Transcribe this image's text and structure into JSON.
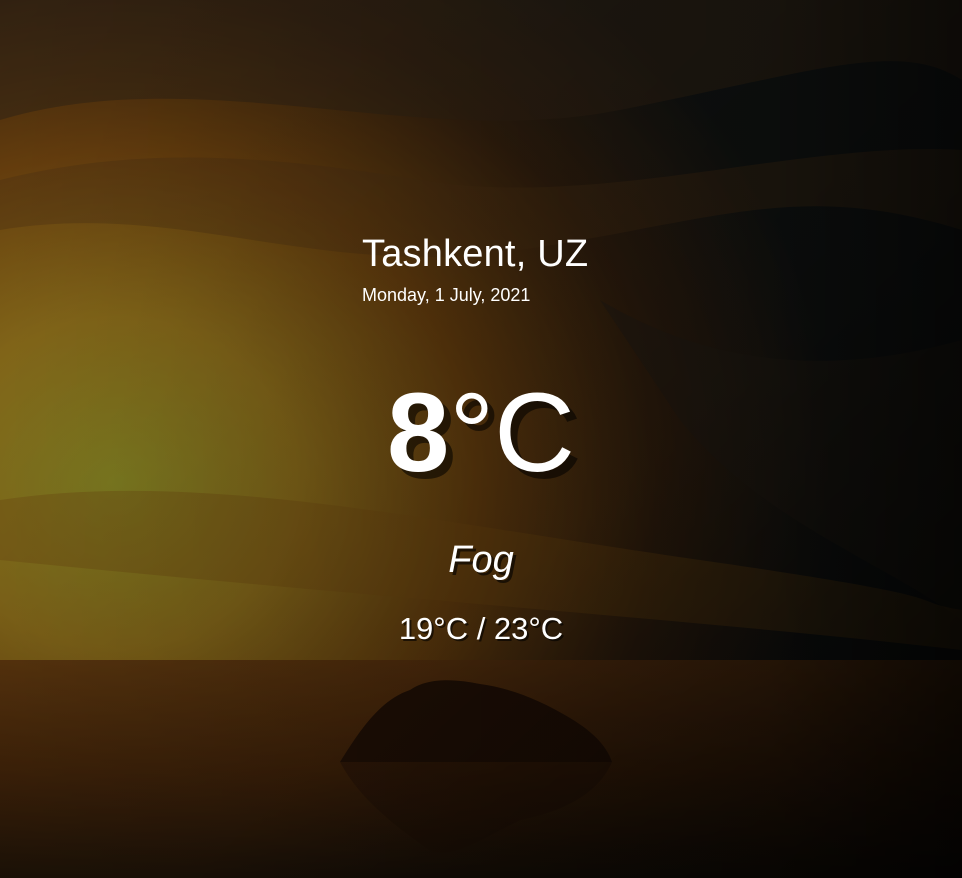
{
  "location": {
    "city": "Tashkent, UZ",
    "date": "Monday, 1 July, 2021"
  },
  "current": {
    "temp_value": "8",
    "temp_unit": "°C",
    "condition": "Fog",
    "hi_low": "19°C / 23°C"
  },
  "background": {
    "scene": "sunset-island-over-water",
    "colors": {
      "sky_glow": "#b88a1e",
      "sky_orange": "#9a5a10",
      "sky_dark": "#151a1c",
      "water": "#5a2e0a",
      "island": "#2a1406"
    }
  }
}
